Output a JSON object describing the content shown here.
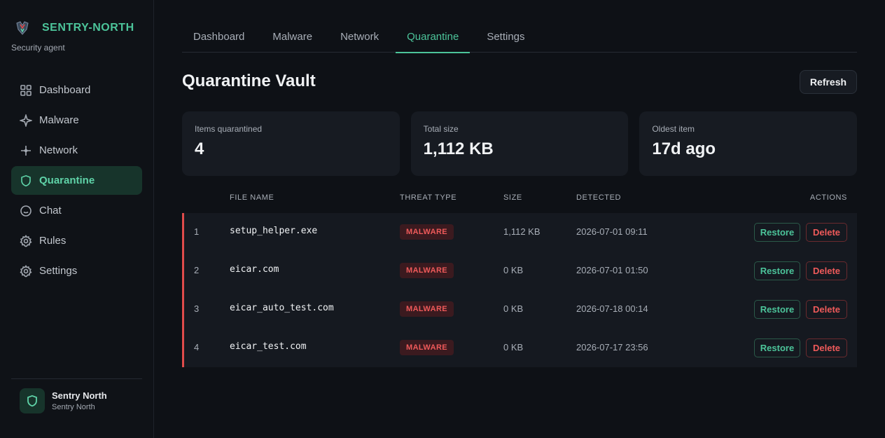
{
  "sidebar": {
    "brand": "SENTRY-NORTH",
    "subtitle": "Security agent",
    "items": [
      {
        "label": "Dashboard",
        "icon": "grid-icon",
        "active": false
      },
      {
        "label": "Malware",
        "icon": "sparkle-icon",
        "active": false
      },
      {
        "label": "Network",
        "icon": "network-icon",
        "active": false
      },
      {
        "label": "Quarantine",
        "icon": "shield-icon",
        "active": true
      },
      {
        "label": "Chat",
        "icon": "chat-icon",
        "active": false
      },
      {
        "label": "Rules",
        "icon": "gear-icon",
        "active": false
      },
      {
        "label": "Settings",
        "icon": "gear-icon",
        "active": false
      }
    ],
    "user": {
      "name": "Sentry North",
      "sub": "Sentry North"
    }
  },
  "tabs": [
    "Dashboard",
    "Malware",
    "Network",
    "Quarantine",
    "Settings"
  ],
  "active_tab": "Quarantine",
  "page": {
    "title": "Quarantine Vault",
    "refresh_label": "Refresh"
  },
  "stats": [
    {
      "label": "Items quarantined",
      "value": "4"
    },
    {
      "label": "Total size",
      "value": "1,112 KB"
    },
    {
      "label": "Oldest item",
      "value": "17d ago"
    }
  ],
  "table": {
    "headers": {
      "file": "FILE NAME",
      "threat": "THREAT TYPE",
      "size": "SIZE",
      "detected": "DETECTED",
      "actions": "ACTIONS"
    },
    "rows": [
      {
        "num": "1",
        "file": "setup_helper.exe",
        "threat": "MALWARE",
        "size": "1,112 KB",
        "detected": "2026-07-01 09:11"
      },
      {
        "num": "2",
        "file": "eicar.com",
        "threat": "MALWARE",
        "size": "0 KB",
        "detected": "2026-07-01 01:50"
      },
      {
        "num": "3",
        "file": "eicar_auto_test.com",
        "threat": "MALWARE",
        "size": "0 KB",
        "detected": "2026-07-18 00:14"
      },
      {
        "num": "4",
        "file": "eicar_test.com",
        "threat": "MALWARE",
        "size": "0 KB",
        "detected": "2026-07-17 23:56"
      }
    ],
    "restore_label": "Restore",
    "delete_label": "Delete"
  },
  "colors": {
    "accent": "#4cc49a",
    "danger": "#ef5a5a",
    "background": "#0e1116"
  }
}
